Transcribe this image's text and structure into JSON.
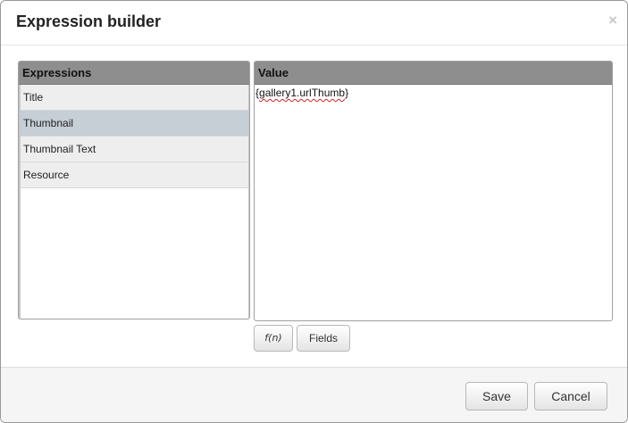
{
  "dialog": {
    "title": "Expression builder",
    "close_glyph": "×"
  },
  "expressions": {
    "header": "Expressions",
    "items": [
      {
        "label": "Title",
        "selected": false
      },
      {
        "label": "Thumbnail",
        "selected": true
      },
      {
        "label": "Thumbnail Text",
        "selected": false
      },
      {
        "label": "Resource",
        "selected": false
      }
    ]
  },
  "value": {
    "header": "Value",
    "open_brace": "{",
    "text": "gallery1.urlThumb",
    "close_brace": "}"
  },
  "toolbar": {
    "fn_label": "f(n)",
    "fields_label": "Fields"
  },
  "footer": {
    "save_label": "Save",
    "cancel_label": "Cancel"
  },
  "colors": {
    "panel_header": "#8e8e8e",
    "selected_row": "#c6ced6",
    "row": "#eeeeee",
    "footer": "#f5f5f5"
  }
}
